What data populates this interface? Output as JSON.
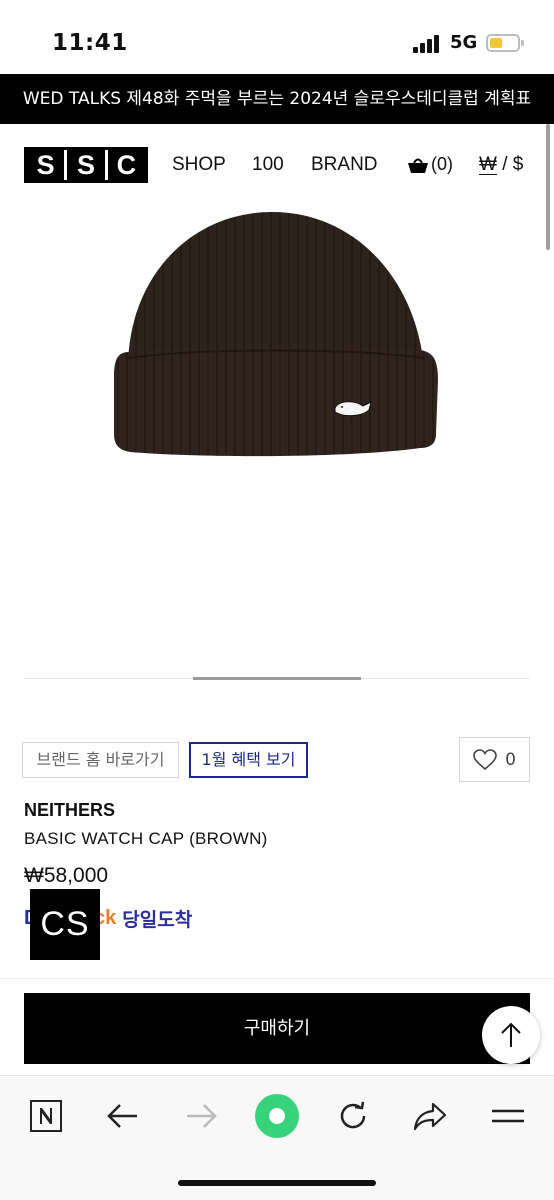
{
  "status_bar": {
    "time": "11:41",
    "network": "5G"
  },
  "announcement": {
    "text": "WED TALKS 제48화 주먹을 부르는 2024년 슬로우스테디클럽 계획표"
  },
  "header": {
    "logo_letters": [
      "S",
      "S",
      "C"
    ],
    "nav": {
      "shop": "SHOP",
      "hundred": "100",
      "brand": "BRAND"
    },
    "cart_count": "(0)",
    "currency_won": "₩",
    "currency_sep": " / ",
    "currency_usd": "$"
  },
  "product": {
    "brand_button": "브랜드 홈 바로가기",
    "benefit_button": "1월 혜택 보기",
    "like_count": "0",
    "brand": "NEITHERS",
    "name": "BASIC WATCH CAP (BROWN)",
    "price": "₩58,000",
    "delivery_brand_lead": "D",
    "delivery_brand_tail": "ck",
    "delivery_text": "당일도착",
    "watermark": "CS"
  },
  "purchase": {
    "buy_label": "구매하기"
  },
  "icons": {
    "cart": "cart-icon",
    "heart": "heart-icon",
    "up_arrow": "arrow-up-icon",
    "browser": [
      "naver-icon",
      "back-icon",
      "forward-icon",
      "green-dot-icon",
      "reload-icon",
      "share-icon",
      "menu-icon"
    ]
  },
  "colors": {
    "benefit_border": "#1d2a8c",
    "delivery_blue": "#2b2f9a",
    "delivery_orange": "#f07a28",
    "beanie": "#2e221d"
  }
}
